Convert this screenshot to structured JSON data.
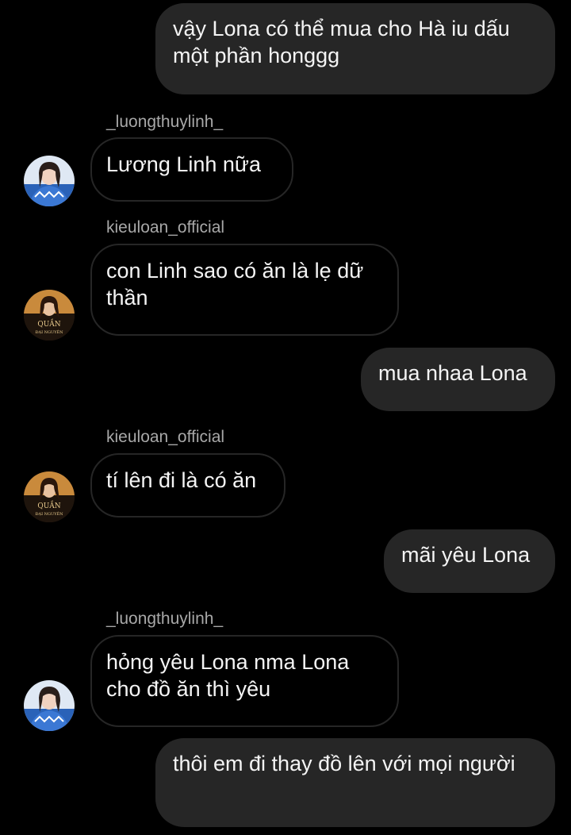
{
  "colors": {
    "background": "#000000",
    "outgoing_bubble": "#262626",
    "incoming_border": "#262626",
    "message_text": "#f4f4f4",
    "sender_text": "#a8a8a8"
  },
  "messages": [
    {
      "type": "outgoing",
      "text": "vậy Lona có thể mua cho Hà iu dấu một phần honggg"
    },
    {
      "type": "incoming",
      "sender": "_luongthuylinh_",
      "avatar": "linh-avatar",
      "text": "Lương Linh nữa"
    },
    {
      "type": "incoming",
      "sender": "kieuloan_official",
      "avatar": "loan-avatar",
      "text": "con Linh sao có ăn là lẹ dữ thần"
    },
    {
      "type": "outgoing",
      "text": "mua nhaa Lona"
    },
    {
      "type": "incoming",
      "sender": "kieuloan_official",
      "avatar": "loan-avatar",
      "text": "tí lên đi là có ăn"
    },
    {
      "type": "outgoing",
      "text": "mãi yêu Lona"
    },
    {
      "type": "incoming",
      "sender": "_luongthuylinh_",
      "avatar": "linh-avatar",
      "text": "hỏng yêu Lona nma Lona cho đồ ăn thì yêu"
    },
    {
      "type": "outgoing",
      "text": "thôi em đi thay đồ lên với mọi người"
    }
  ]
}
